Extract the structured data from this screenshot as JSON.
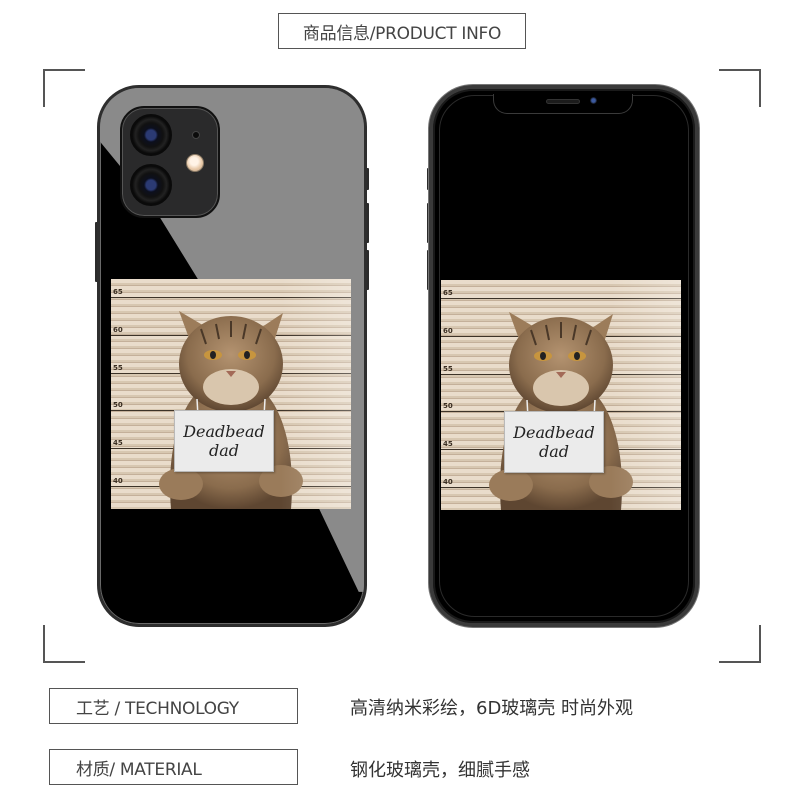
{
  "header": {
    "title": "商品信息/PRODUCT INFO"
  },
  "product_image": {
    "back_view": {
      "print": {
        "height_marks": [
          "65",
          "60",
          "55",
          "50",
          "45",
          "40"
        ],
        "sign_text_line1": "Deadbead",
        "sign_text_line2": "dad"
      },
      "background_color": "#000000"
    },
    "front_view": {
      "print": {
        "height_marks": [
          "65",
          "60",
          "55",
          "50",
          "45",
          "40"
        ],
        "sign_text_line1": "Deadbead",
        "sign_text_line2": "dad"
      },
      "background_color": "#000000"
    }
  },
  "specs": [
    {
      "label": "工艺 / TECHNOLOGY",
      "value": "高清纳米彩绘，6D玻璃壳 时尚外观"
    },
    {
      "label": "材质/ MATERIAL",
      "value": "钢化玻璃壳，细腻手感"
    }
  ]
}
